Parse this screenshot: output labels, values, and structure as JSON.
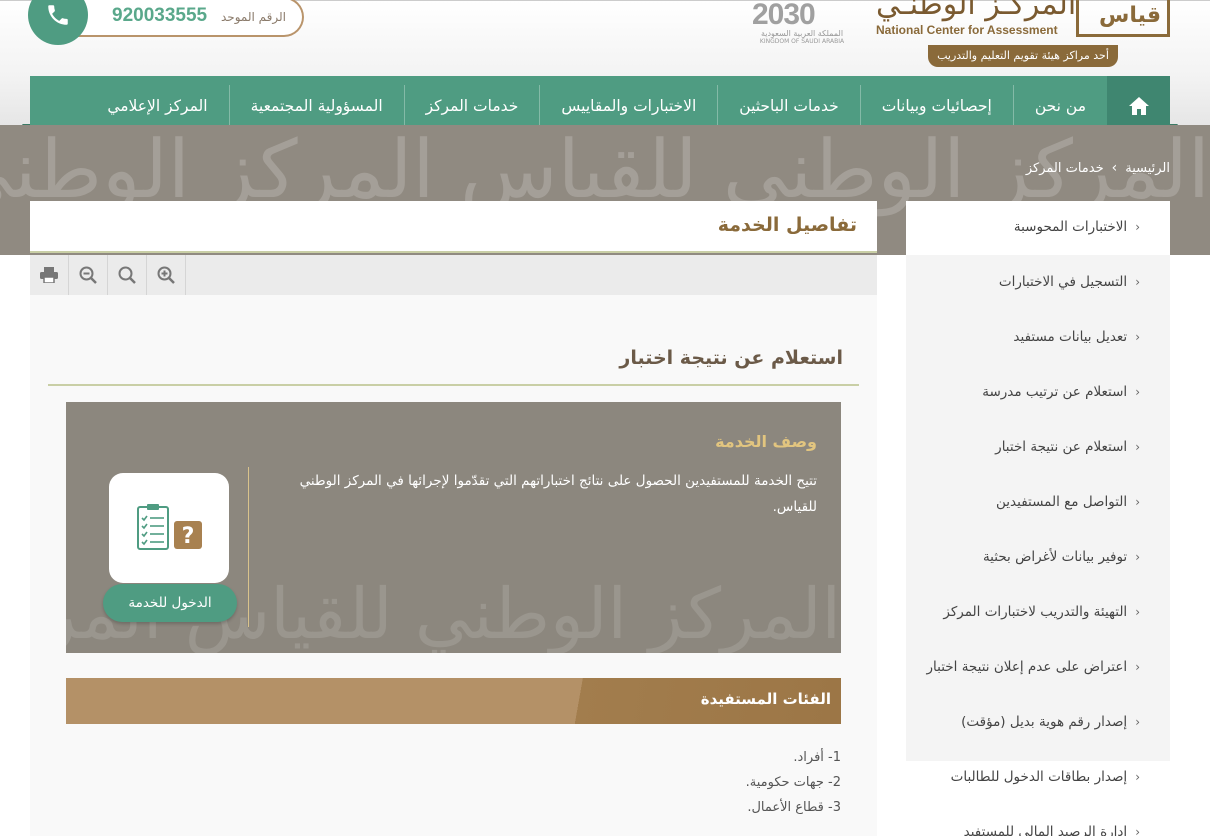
{
  "header": {
    "phone_label": "الرقم الموحد",
    "phone_number": "920033555",
    "vision_year": "2030",
    "vision_arabic": "المملكة العربية السعودية",
    "vision_english": "KINGDOM OF SAUDI ARABIA",
    "logo_arabic": "قياس",
    "logo_english": "National Center for Assessment",
    "logo_tagline": "أحد مراكز هيئة تقويم التعليم والتدريب"
  },
  "nav": {
    "home_icon": "home-icon",
    "items": [
      {
        "label": "من نحن"
      },
      {
        "label": "إحصائيات وبيانات"
      },
      {
        "label": "خدمات الباحثين"
      },
      {
        "label": "الاختبارات والمقاييس"
      },
      {
        "label": "خدمات المركز"
      },
      {
        "label": "المسؤولية المجتمعية"
      },
      {
        "label": "المركز الإعلامي"
      }
    ]
  },
  "breadcrumb": {
    "home": "الرئيسية",
    "separator": "›",
    "current": "خدمات المركز"
  },
  "sidebar": {
    "items": [
      {
        "label": "الاختبارات المحوسبة"
      },
      {
        "label": "التسجيل في الاختبارات"
      },
      {
        "label": "تعديل بيانات مستفيد"
      },
      {
        "label": "استعلام عن ترتيب مدرسة"
      },
      {
        "label": "استعلام عن نتيجة اختبار"
      },
      {
        "label": "التواصل مع المستفيدين"
      },
      {
        "label": "توفير بيانات لأغراض بحثية"
      },
      {
        "label": "التهيئة والتدريب لاختبارات المركز"
      },
      {
        "label": "اعتراض على عدم إعلان نتيجة اختبار"
      },
      {
        "label": "إصدار رقم هوية بديل (مؤقت)"
      },
      {
        "label": "إصدار بطاقات الدخول للطالبات"
      },
      {
        "label": "إدارة الرصيد المالي للمستفيد"
      }
    ]
  },
  "main": {
    "title": "تفاصيل الخدمة",
    "toolbar": [
      "print-icon",
      "zoom-out-icon",
      "search-icon",
      "zoom-in-icon"
    ],
    "service_title": "استعلام عن نتيجة اختبار",
    "description_heading": "وصف الخدمة",
    "description_text": "تتيح الخدمة للمستفيدين الحصول على نتائج اختباراتهم التي تقدّموا لإجرائها في المركز الوطني للقياس.",
    "enter_button": "الدخول للخدمة",
    "categories_title": "الفئات المستفيدة",
    "categories": [
      "1- أفراد.",
      "2- جهات حكومية.",
      "3- قطاع الأعمال."
    ]
  },
  "colors": {
    "accent_green": "#4f9c82",
    "brown": "#8a6a3a",
    "gold": "#e2c57f"
  }
}
